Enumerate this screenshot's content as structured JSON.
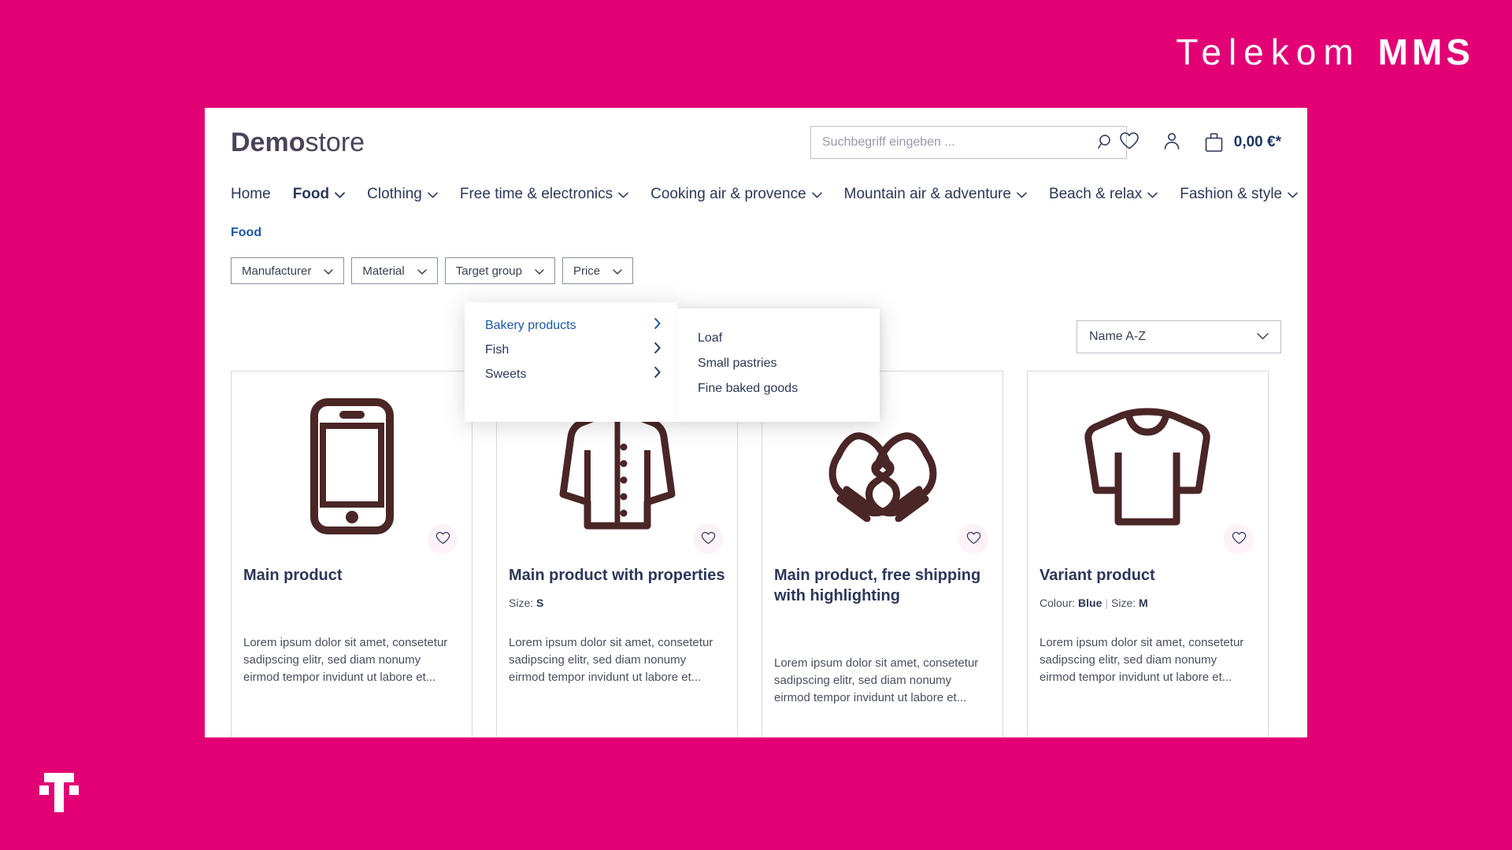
{
  "brand": {
    "telekom": "Telekom",
    "mms": "MMS",
    "t_logo": "telekom-t-logo",
    "magenta": "#e20074"
  },
  "shop": {
    "logo": {
      "bold": "Demo",
      "regular": "store"
    },
    "search": {
      "placeholder": "Suchbegriff eingeben ...",
      "value": "",
      "icon": "search-icon"
    },
    "header_actions": {
      "wishlist_icon": "heart-icon",
      "account_icon": "person-icon",
      "cart_icon": "shopping-bag-icon",
      "cart_amount": "0,00 €*"
    },
    "nav": [
      {
        "label": "Home",
        "has_chevron": false,
        "active": false
      },
      {
        "label": "Food",
        "has_chevron": true,
        "active": true
      },
      {
        "label": "Clothing",
        "has_chevron": true,
        "active": false
      },
      {
        "label": "Free time & electronics",
        "has_chevron": true,
        "active": false
      },
      {
        "label": "Cooking air & provence",
        "has_chevron": true,
        "active": false
      },
      {
        "label": "Mountain air & adventure",
        "has_chevron": true,
        "active": false
      },
      {
        "label": "Beach & relax",
        "has_chevron": true,
        "active": false
      },
      {
        "label": "Fashion & style",
        "has_chevron": true,
        "active": false
      }
    ],
    "flyout": {
      "categories": [
        {
          "label": "Bakery products",
          "active": true
        },
        {
          "label": "Fish",
          "active": false
        },
        {
          "label": "Sweets",
          "active": false
        }
      ],
      "subcategories": [
        {
          "label": "Loaf"
        },
        {
          "label": "Small pastries"
        },
        {
          "label": "Fine baked goods"
        }
      ]
    },
    "breadcrumb": "Food",
    "filters": [
      {
        "label": "Manufacturer"
      },
      {
        "label": "Material"
      },
      {
        "label": "Target group"
      },
      {
        "label": "Price"
      }
    ],
    "sort": {
      "selected": "Name A-Z",
      "icon": "chevron-down-icon"
    },
    "products": [
      {
        "title": "Main product",
        "properties": "",
        "description": "Lorem ipsum dolor sit amet, consetetur sadipscing elitr, sed diam nonumy eirmod tempor invidunt ut labore et...",
        "image": "smartphone-icon"
      },
      {
        "title": "Main product with properties",
        "properties": "Size: S",
        "prop_label_1": "Size: ",
        "prop_value_1": "S",
        "description": "Lorem ipsum dolor sit amet, consetetur sadipscing elitr, sed diam nonumy eirmod tempor invidunt ut labore et...",
        "image": "jacket-icon"
      },
      {
        "title": "Main product, free shipping with highlighting",
        "properties": "",
        "description": "Lorem ipsum dolor sit amet, consetetur sadipscing elitr, sed diam nonumy eirmod tempor invidunt ut labore et...",
        "image": "mittens-icon"
      },
      {
        "title": "Variant product",
        "prop_label_1": "Colour: ",
        "prop_value_1": "Blue",
        "prop_label_2": "Size: ",
        "prop_value_2": "M",
        "description": "Lorem ipsum dolor sit amet, consetetur sadipscing elitr, sed diam nonumy eirmod tempor invidunt ut labore et...",
        "image": "sweater-icon"
      }
    ],
    "colors": {
      "nav_text": "#2c3759",
      "link_blue": "#1d56a5",
      "product_icon": "#4a2626"
    }
  }
}
